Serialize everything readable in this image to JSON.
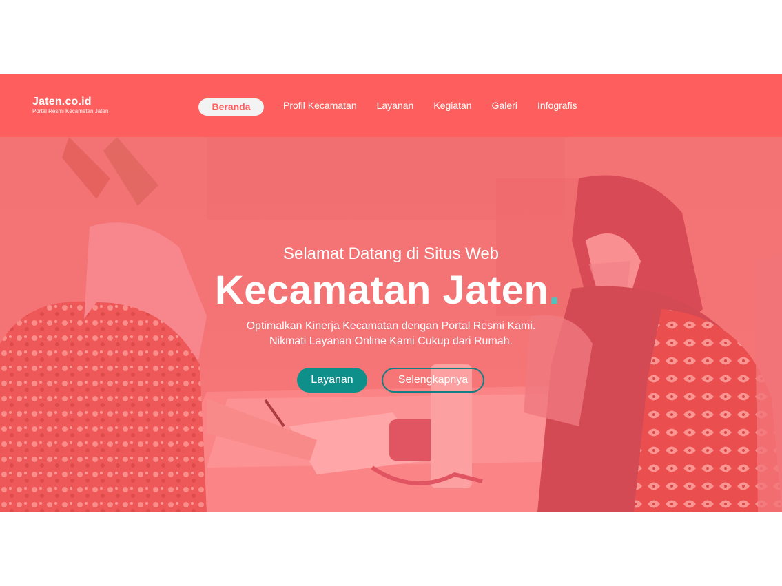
{
  "colors": {
    "navbar": "#ff5e5e",
    "hero_tint": "#ff5f64",
    "primary_button": "#0e8f8a",
    "accent_dot": "#4fc3c0",
    "outline_border": "#137f85"
  },
  "brand": {
    "name": "Jaten.co.id",
    "tagline": "Portal Resmi Kecamatan Jaten"
  },
  "nav": {
    "active": "Beranda",
    "items": [
      "Profil Kecamatan",
      "Layanan",
      "Kegiatan",
      "Galeri",
      "Infografis"
    ]
  },
  "hero": {
    "kicker": "Selamat Datang di Situs Web",
    "title": "Kecamatan Jaten",
    "title_dot": ".",
    "desc_line1": "Optimalkan Kinerja Kecamatan dengan Portal Resmi Kami.",
    "desc_line2": "Nikmati Layanan Online Kami Cukup dari Rumah.",
    "primary_button": "Layanan",
    "secondary_button": "Selengkapnya"
  }
}
